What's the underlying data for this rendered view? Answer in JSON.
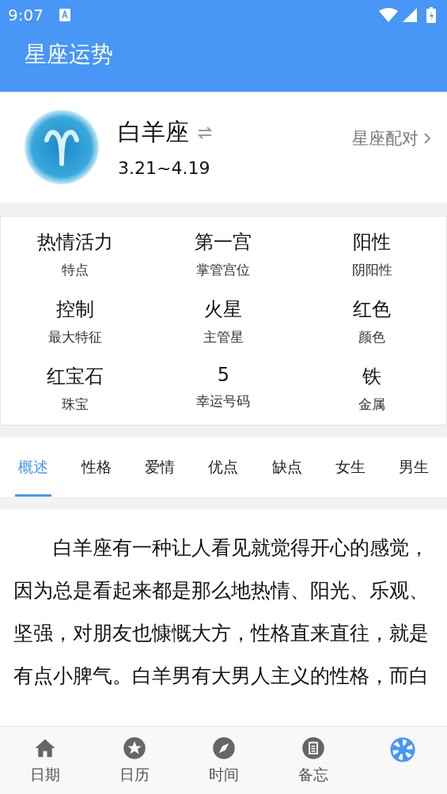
{
  "status_bar": {
    "time": "9:07"
  },
  "header": {
    "title": "星座运势"
  },
  "sign": {
    "name": "白羊座",
    "dates": "3.21~4.19",
    "match_link": "星座配对"
  },
  "attributes": [
    {
      "value": "热情活力",
      "label": "特点"
    },
    {
      "value": "第一宫",
      "label": "掌管宫位"
    },
    {
      "value": "阳性",
      "label": "阴阳性"
    },
    {
      "value": "控制",
      "label": "最大特征"
    },
    {
      "value": "火星",
      "label": "主管星"
    },
    {
      "value": "红色",
      "label": "颜色"
    },
    {
      "value": "红宝石",
      "label": "珠宝"
    },
    {
      "value": "5",
      "label": "幸运号码"
    },
    {
      "value": "铁",
      "label": "金属"
    }
  ],
  "tabs": [
    {
      "label": "概述",
      "selected": true
    },
    {
      "label": "性格",
      "selected": false
    },
    {
      "label": "爱情",
      "selected": false
    },
    {
      "label": "优点",
      "selected": false
    },
    {
      "label": "缺点",
      "selected": false
    },
    {
      "label": "女生",
      "selected": false
    },
    {
      "label": "男生",
      "selected": false
    }
  ],
  "description": "白羊座有一种让人看见就觉得开心的感觉，因为总是看起来都是那么地热情、阳光、乐观、坚强，对朋友也慷慨大方，性格直来直往，就是有点小脾气。白羊男有大男人主义的性格，而白",
  "bottom_nav": [
    {
      "kind": "home",
      "label": "日期",
      "selected": false
    },
    {
      "kind": "star",
      "label": "日历",
      "selected": false
    },
    {
      "kind": "compass",
      "label": "时间",
      "selected": false
    },
    {
      "kind": "clipboard",
      "label": "备忘",
      "selected": false
    },
    {
      "kind": "aperture",
      "selected": true
    }
  ]
}
